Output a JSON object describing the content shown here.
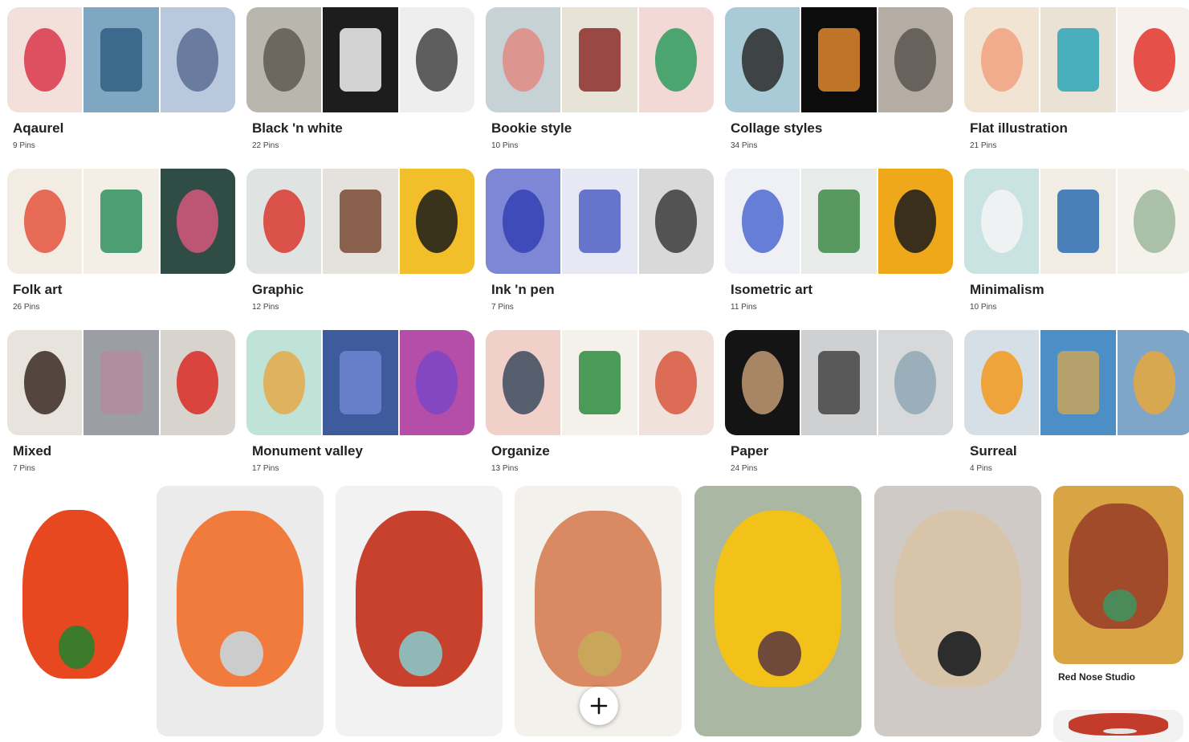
{
  "boards": [
    {
      "name": "Aqaurel",
      "count": "9 Pins",
      "colors": [
        "#f3e0da",
        "#7fa7c2",
        "#b9c8dc"
      ],
      "accents": [
        "#d9364a",
        "#2f5f82",
        "#5b6d94"
      ]
    },
    {
      "name": "Black 'n white",
      "count": "22 Pins",
      "colors": [
        "#b9b6ae",
        "#1d1d1d",
        "#eeeeee"
      ],
      "accents": [
        "#5e5a52",
        "#f2f2f2",
        "#444444"
      ]
    },
    {
      "name": "Bookie style",
      "count": "10 Pins",
      "colors": [
        "#c6d2d6",
        "#e8e3d7",
        "#f3d9d6"
      ],
      "accents": [
        "#e08b84",
        "#8b2d2a",
        "#2e9a5d"
      ]
    },
    {
      "name": "Collage styles",
      "count": "34 Pins",
      "colors": [
        "#a9cbd8",
        "#0c0c0c",
        "#b5aca3"
      ],
      "accents": [
        "#2b2b2b",
        "#e0872e",
        "#5b5550"
      ]
    },
    {
      "name": "Flat illustration",
      "count": "21 Pins",
      "colors": [
        "#f2e4d3",
        "#e9e2d5",
        "#f6f1ec"
      ],
      "accents": [
        "#f0a27f",
        "#2ea6b9",
        "#e2342c"
      ]
    },
    {
      "name": "Folk art",
      "count": "26 Pins",
      "colors": [
        "#f3ece2",
        "#f4efe6",
        "#2f4d45"
      ],
      "accents": [
        "#e4533d",
        "#2f8f5e",
        "#d6577d"
      ]
    },
    {
      "name": "Graphic",
      "count": "12 Pins",
      "colors": [
        "#dfe4e3",
        "#e5e2dd",
        "#f2bf2a"
      ],
      "accents": [
        "#d9382f",
        "#7a4a32",
        "#1a1a1a"
      ]
    },
    {
      "name": "Ink 'n pen",
      "count": "7 Pins",
      "colors": [
        "#7e87d6",
        "#e6e9f3",
        "#d9d9d9"
      ],
      "accents": [
        "#3441b3",
        "#4f5fc4",
        "#3b3b3b"
      ]
    },
    {
      "name": "Isometric art",
      "count": "11 Pins",
      "colors": [
        "#eef0f6",
        "#e7ecea",
        "#f0a81b"
      ],
      "accents": [
        "#4f6ad0",
        "#3f8a46",
        "#1a1a1a"
      ]
    },
    {
      "name": "Minimalism",
      "count": "10 Pins",
      "colors": [
        "#c9e2e2",
        "#f1ece4",
        "#f5f1eb"
      ],
      "accents": [
        "#f4f4f4",
        "#2d6db2",
        "#9cb79d"
      ]
    },
    {
      "name": "Mixed",
      "count": "7 Pins",
      "colors": [
        "#e8e3dd",
        "#9b9fa5",
        "#d9d3cd"
      ],
      "accents": [
        "#3a2a22",
        "#b48aa0",
        "#d82a25"
      ]
    },
    {
      "name": "Monument valley",
      "count": "17 Pins",
      "colors": [
        "#bfe3d7",
        "#3e5b9d",
        "#b44ea9"
      ],
      "accents": [
        "#e4a94a",
        "#6e86d1",
        "#7d45c6"
      ]
    },
    {
      "name": "Organize",
      "count": "13 Pins",
      "colors": [
        "#f0d0c9",
        "#f4f1ea",
        "#f0e2da"
      ],
      "accents": [
        "#3c4a5e",
        "#2e8b3d",
        "#d9573f"
      ]
    },
    {
      "name": "Paper",
      "count": "24 Pins",
      "colors": [
        "#141414",
        "#cfd0d2",
        "#d7d8d9"
      ],
      "accents": [
        "#c09a72",
        "#444444",
        "#8fa8b4"
      ]
    },
    {
      "name": "Surreal",
      "count": "4 Pins",
      "colors": [
        "#d7dfe6",
        "#4b8fc6",
        "#7fa6c8"
      ],
      "accents": [
        "#f29a1c",
        "#c8a45a",
        "#e7a83c"
      ]
    }
  ],
  "pins": [
    {
      "label": "tomato-photo",
      "bg": "#ffffff",
      "accent": "#e8481f",
      "accent2": "#3c7a2c"
    },
    {
      "label": "carrot-poster",
      "bg": "#ebebeb",
      "accent": "#f07b3d",
      "accent2": "#cccccc"
    },
    {
      "label": "clay-hat-figure",
      "bg": "#f2f2f2",
      "accent": "#c8412d",
      "accent2": "#8fb8b7"
    },
    {
      "label": "clay-man-figure",
      "bg": "#f3f1ec",
      "accent": "#d98a62",
      "accent2": "#c9a65a"
    },
    {
      "label": "hazmat-figure",
      "bg": "#a9b7a3",
      "accent": "#f2c21a",
      "accent2": "#6f4a3a"
    },
    {
      "label": "explorer-figure",
      "bg": "#cfcac5",
      "accent": "#d7c4a9",
      "accent2": "#2d2d2d"
    },
    {
      "label": "red-nose-studio-pin",
      "bg": "#d9a544",
      "accent": "#a24b2b",
      "accent2": "#4d8a5a"
    },
    {
      "label": "small-bottom-pin",
      "bg": "#f2f2f2",
      "accent": "#c23b2b",
      "accent2": "#e4e4e4"
    }
  ],
  "pin_captions": {
    "red_nose": "Red Nose Studio"
  },
  "add_button": {
    "icon": "plus-icon"
  }
}
